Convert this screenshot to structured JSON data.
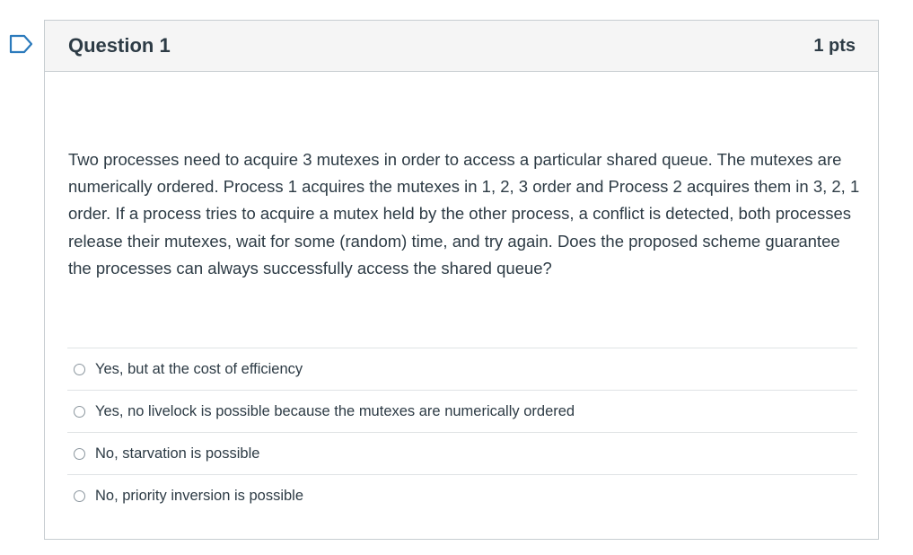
{
  "question": {
    "title": "Question 1",
    "points": "1 pts",
    "text": "Two processes need to acquire 3 mutexes in order to access a particular shared queue. The mutexes are numerically ordered. Process 1 acquires the mutexes in 1, 2, 3 order and Process 2 acquires them in 3, 2, 1 order. If a process tries to acquire a mutex held by the other process, a conflict is detected, both processes release their mutexes, wait for some (random) time, and try again. Does the proposed scheme guarantee the processes can always successfully access the shared queue?"
  },
  "answers": [
    {
      "label": "Yes, but at the cost of efficiency"
    },
    {
      "label": "Yes, no livelock is possible because the mutexes are numerically ordered"
    },
    {
      "label": "No, starvation is possible"
    },
    {
      "label": "No, priority inversion is possible"
    }
  ],
  "flag": {
    "icon": "bookmark-flag-icon",
    "color": "#2b7abc"
  }
}
